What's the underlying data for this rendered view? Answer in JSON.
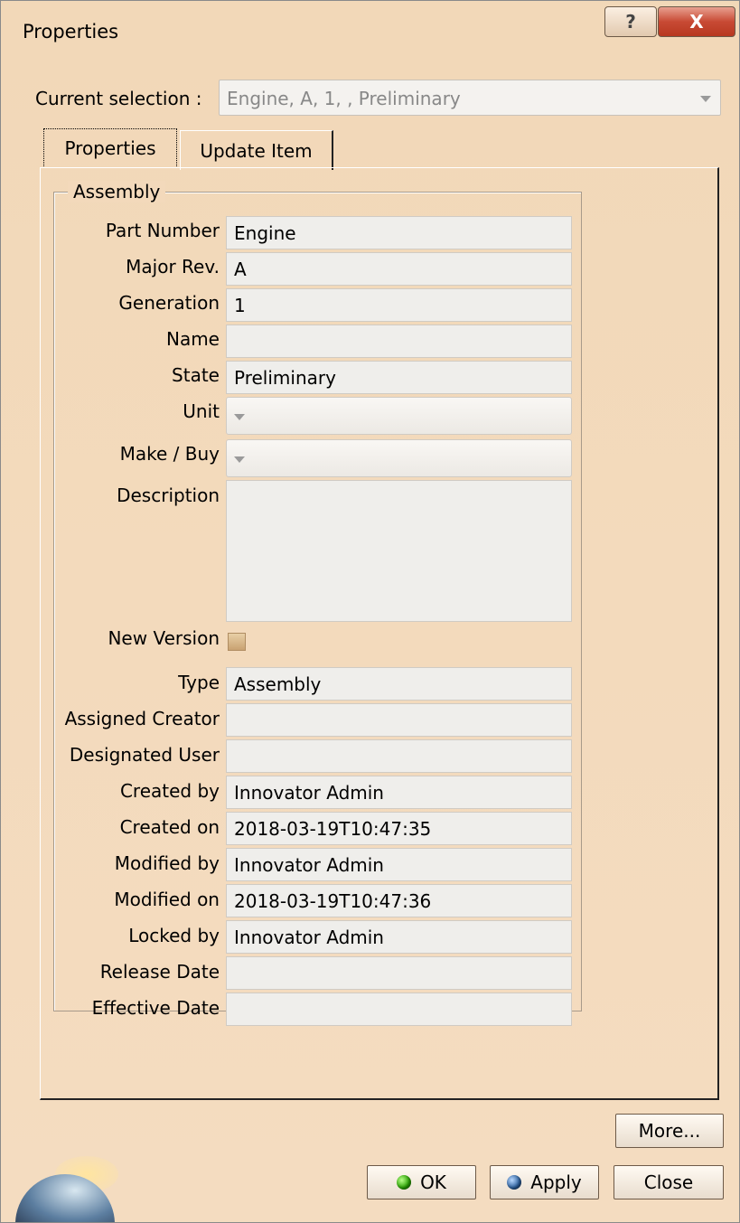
{
  "window": {
    "title": "Properties",
    "help_glyph": "?",
    "close_glyph": "X"
  },
  "selection": {
    "label": "Current selection :",
    "value": "Engine, A, 1, , Preliminary"
  },
  "tabs": [
    "Properties",
    "Update Item"
  ],
  "group": {
    "title": "Assembly"
  },
  "fields": {
    "part_number": {
      "label": "Part Number",
      "value": "Engine"
    },
    "major_rev": {
      "label": "Major Rev.",
      "value": "A"
    },
    "generation": {
      "label": "Generation",
      "value": "1"
    },
    "name": {
      "label": "Name",
      "value": ""
    },
    "state": {
      "label": "State",
      "value": "Preliminary"
    },
    "unit": {
      "label": "Unit",
      "value": ""
    },
    "make_buy": {
      "label": "Make / Buy",
      "value": ""
    },
    "description": {
      "label": "Description",
      "value": ""
    },
    "new_version": {
      "label": "New Version",
      "checked": false
    },
    "type": {
      "label": "Type",
      "value": "Assembly"
    },
    "assigned_creator": {
      "label": "Assigned Creator",
      "value": ""
    },
    "designated_user": {
      "label": "Designated User",
      "value": ""
    },
    "created_by": {
      "label": "Created by",
      "value": "Innovator Admin"
    },
    "created_on": {
      "label": "Created on",
      "value": "2018-03-19T10:47:35"
    },
    "modified_by": {
      "label": "Modified by",
      "value": "Innovator Admin"
    },
    "modified_on": {
      "label": "Modified on",
      "value": "2018-03-19T10:47:36"
    },
    "locked_by": {
      "label": "Locked by",
      "value": "Innovator Admin"
    },
    "release_date": {
      "label": "Release Date",
      "value": ""
    },
    "effective_date": {
      "label": "Effective Date",
      "value": ""
    }
  },
  "buttons": {
    "more": "More...",
    "ok": "OK",
    "apply": "Apply",
    "close": "Close"
  },
  "colors": {
    "dialog_bg": "#f2d8b8",
    "field_bg": "#efeeeb",
    "close_red": "#c84a34",
    "ok_green": "#27a100",
    "apply_blue": "#2a5e9c"
  },
  "icons": {
    "ok": "green-orb-icon",
    "apply": "blue-orb-icon",
    "help": "help-icon",
    "close": "close-icon",
    "logo": "app-logo"
  }
}
